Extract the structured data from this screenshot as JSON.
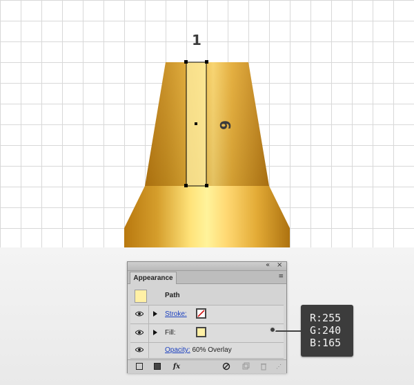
{
  "canvas": {
    "step_label": "1",
    "rotated_label": "6",
    "colors": {
      "grid": "#d8d8d8",
      "selection": "#000000",
      "rect_fill": "#fff0a5",
      "gold_dark": "#b57a12",
      "gold_light": "#ffe68a"
    }
  },
  "panel": {
    "tab_label": "Appearance",
    "titlebar_buttons": [
      "«",
      "×"
    ],
    "menu_icon": "≡",
    "path_label": "Path",
    "stroke_label": "Stroke:",
    "fill_label": "Fill:",
    "opacity_label": "Opacity:",
    "opacity_value": "60% Overlay",
    "fill_color": "#fff0a5",
    "footer_fx": "fx"
  },
  "callout": {
    "r": "R:255",
    "g": "G:240",
    "b": "B:165"
  }
}
